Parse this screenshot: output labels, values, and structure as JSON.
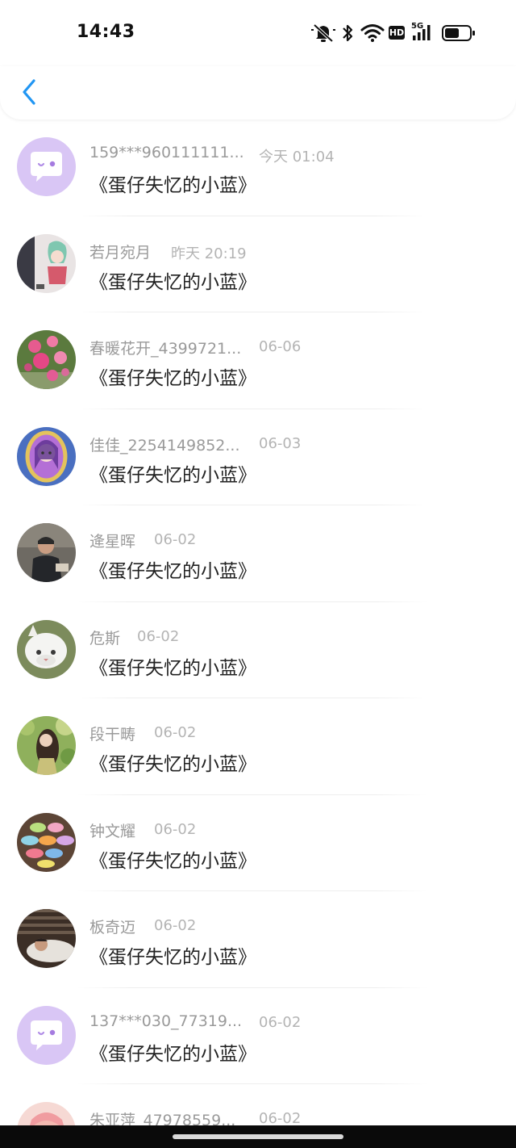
{
  "status_bar": {
    "time": "14:43",
    "icons": [
      "mute-bell-icon",
      "bluetooth-icon",
      "wifi-icon",
      "hd-icon",
      "signal-5g-icon",
      "battery-icon"
    ],
    "hd_label": "HD",
    "net_label": "5G"
  },
  "header": {
    "back_icon": "chevron-left-icon",
    "accent_color": "#2196f3"
  },
  "list": {
    "items": [
      {
        "name": "159***960111111...",
        "time": "今天 01:04",
        "message": "《蛋仔失忆的小蓝》",
        "avatar": "default-chat-avatar"
      },
      {
        "name": "若月宛月",
        "time": "昨天 20:19",
        "message": "《蛋仔失忆的小蓝》",
        "avatar": "anime-girl-avatar"
      },
      {
        "name": "春暖花开_4399721...",
        "time": "06-06",
        "message": "《蛋仔失忆的小蓝》",
        "avatar": "pink-roses-avatar"
      },
      {
        "name": "佳佳_2254149852...",
        "time": "06-03",
        "message": "《蛋仔失忆的小蓝》",
        "avatar": "doll-mirror-avatar"
      },
      {
        "name": "逄星晖",
        "time": "06-02",
        "message": "《蛋仔失忆的小蓝》",
        "avatar": "man-photo-avatar"
      },
      {
        "name": "危斯",
        "time": "06-02",
        "message": "《蛋仔失忆的小蓝》",
        "avatar": "white-cat-avatar"
      },
      {
        "name": "段干畴",
        "time": "06-02",
        "message": "《蛋仔失忆的小蓝》",
        "avatar": "woman-leaves-avatar"
      },
      {
        "name": "钟文耀",
        "time": "06-02",
        "message": "《蛋仔失忆的小蓝》",
        "avatar": "macarons-avatar"
      },
      {
        "name": "板奇迈",
        "time": "06-02",
        "message": "《蛋仔失忆的小蓝》",
        "avatar": "man-lying-avatar"
      },
      {
        "name": "137***030_77319...",
        "time": "06-02",
        "message": "《蛋仔失忆的小蓝》",
        "avatar": "default-chat-avatar"
      },
      {
        "name": "朱亚萍_47978559...",
        "time": "06-02",
        "message": "",
        "avatar": "pink-anime-avatar"
      }
    ]
  },
  "colors": {
    "name": "#9a9a9a",
    "time": "#b4b4b4",
    "message": "#222222",
    "default_avatar_bg": "#d9c6f5"
  }
}
